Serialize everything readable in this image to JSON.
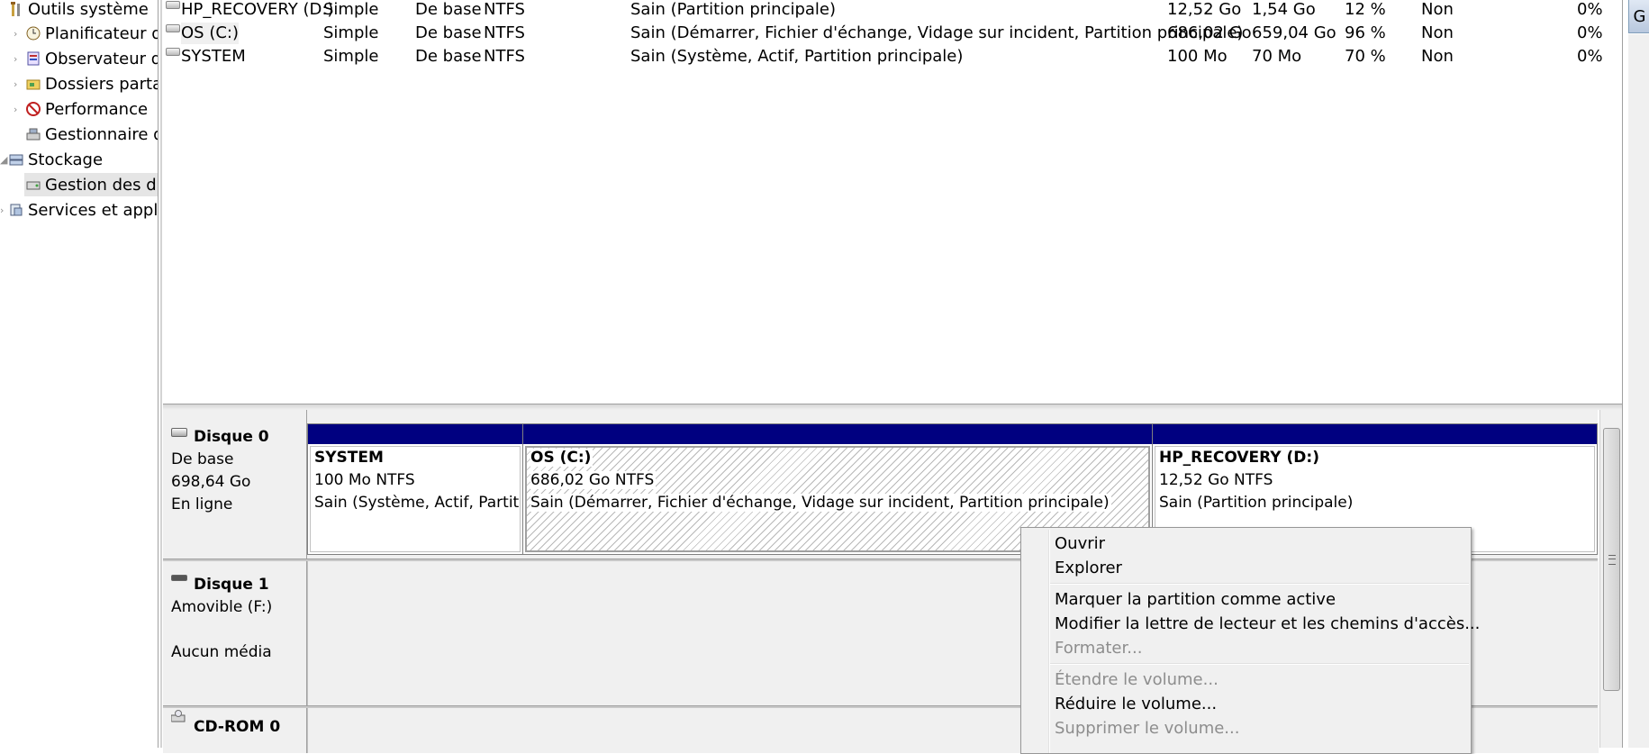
{
  "tree": {
    "items": [
      {
        "label": "Outils système",
        "icon": "tools-icon"
      },
      {
        "label": "Planificateur de",
        "icon": "clock-icon"
      },
      {
        "label": "Observateur d'é",
        "icon": "event-viewer-icon"
      },
      {
        "label": "Dossiers partag",
        "icon": "shared-folder-icon"
      },
      {
        "label": "Performance",
        "icon": "performance-icon"
      },
      {
        "label": "Gestionnaire de",
        "icon": "device-manager-icon"
      },
      {
        "label": "Stockage",
        "icon": "storage-icon"
      },
      {
        "label": "Gestion des disq",
        "icon": "disk-management-icon"
      },
      {
        "label": "Services et applica",
        "icon": "services-icon"
      }
    ]
  },
  "volumes": [
    {
      "name": "HP_RECOVERY (D:)",
      "layout": "Simple",
      "type": "De base",
      "fs": "NTFS",
      "status": "Sain (Partition principale)",
      "capacity": "12,52 Go",
      "free": "1,54 Go",
      "pct_free": "12 %",
      "fault_tolerance": "Non",
      "overhead": "0%"
    },
    {
      "name": "OS (C:)",
      "layout": "Simple",
      "type": "De base",
      "fs": "NTFS",
      "status": "Sain (Démarrer, Fichier d'échange, Vidage sur incident, Partition principale)",
      "capacity": "686,02 Go",
      "free": "659,04 Go",
      "pct_free": "96 %",
      "fault_tolerance": "Non",
      "overhead": "0%"
    },
    {
      "name": "SYSTEM",
      "layout": "Simple",
      "type": "De base",
      "fs": "NTFS",
      "status": "Sain (Système, Actif, Partition principale)",
      "capacity": "100 Mo",
      "free": "70 Mo",
      "pct_free": "70 %",
      "fault_tolerance": "Non",
      "overhead": "0%"
    }
  ],
  "disks": [
    {
      "title": "Disque 0",
      "type": "De base",
      "size": "698,64 Go",
      "state": "En ligne"
    },
    {
      "title": "Disque 1",
      "type": "Amovible (F:)",
      "size": "",
      "state": "Aucun média"
    },
    {
      "title": "CD-ROM 0"
    }
  ],
  "partitions": [
    {
      "name": "SYSTEM",
      "size_fs": "100 Mo NTFS",
      "status": "Sain (Système, Actif, Partition principale)"
    },
    {
      "name": "OS  (C:)",
      "size_fs": "686,02 Go NTFS",
      "status": "Sain (Démarrer, Fichier d'échange, Vidage sur incident, Partition principale)"
    },
    {
      "name": "HP_RECOVERY  (D:)",
      "size_fs": "12,52 Go NTFS",
      "status": "Sain (Partition principale)"
    }
  ],
  "right_button": {
    "label": "G"
  },
  "context_menu": {
    "items": [
      {
        "label": "Ouvrir",
        "enabled": true
      },
      {
        "label": "Explorer",
        "enabled": true
      },
      {
        "label": "Marquer la partition comme active",
        "enabled": true
      },
      {
        "label": "Modifier la lettre de lecteur et les chemins d'accès...",
        "enabled": true
      },
      {
        "label": "Formater...",
        "enabled": false
      },
      {
        "label": "Étendre le volume...",
        "enabled": false
      },
      {
        "label": "Réduire le volume...",
        "enabled": true
      },
      {
        "label": "Supprimer le volume...",
        "enabled": false
      }
    ]
  },
  "colors": {
    "partition_bar": "#000080",
    "menu_bg": "#f0f0f0",
    "disabled_text": "#8d8d8d"
  }
}
